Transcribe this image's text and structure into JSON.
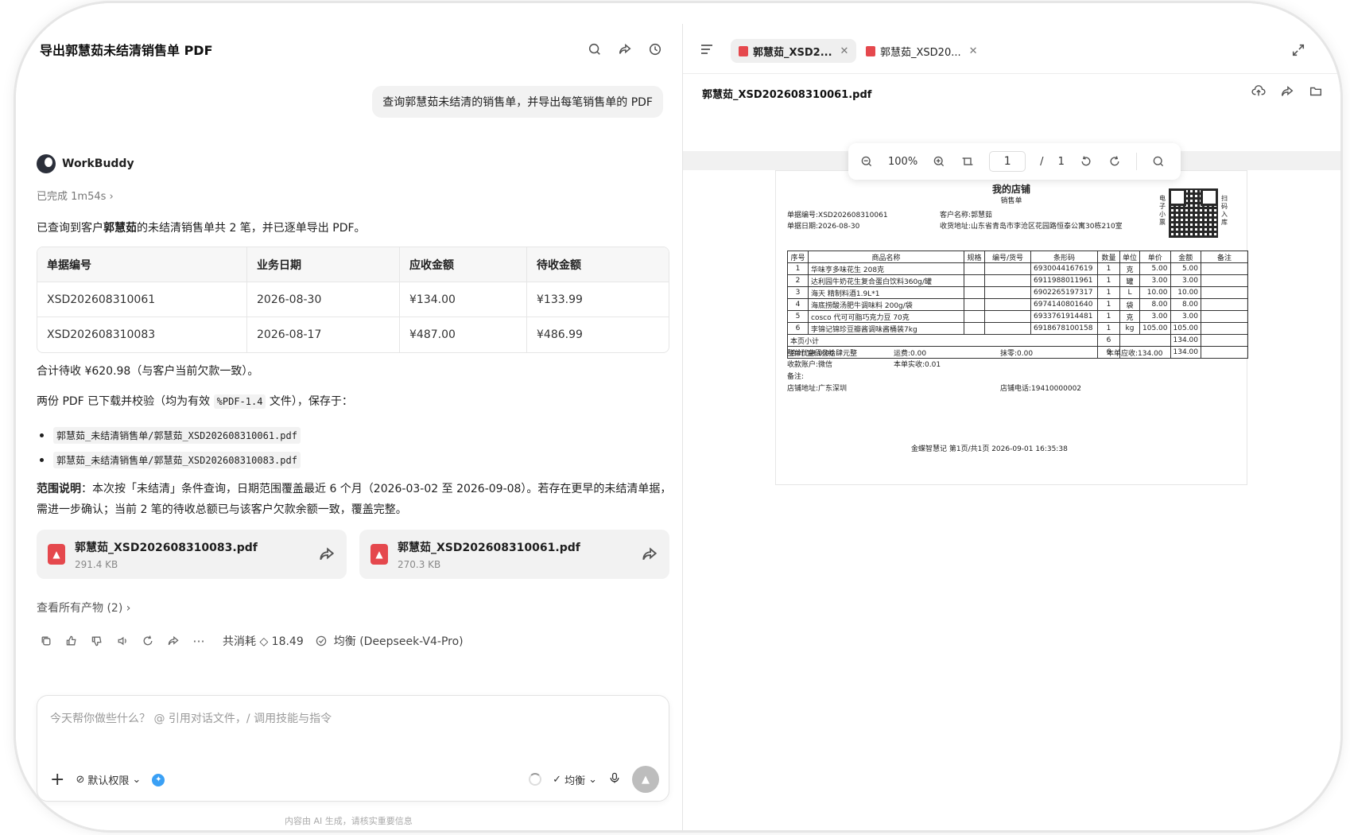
{
  "chat": {
    "title": "导出郭慧茹未结清销售单 PDF",
    "user_message": "查询郭慧茹未结清的销售单，并导出每笔销售单的 PDF",
    "agent_name": "WorkBuddy",
    "status": "已完成 1m54s",
    "summary_prefix": "已查询到客户",
    "summary_customer": "郭慧茹",
    "summary_suffix": "的未结清销售单共 2 笔，并已逐单导出 PDF。",
    "table": {
      "headers": [
        "单据编号",
        "业务日期",
        "应收金额",
        "待收金额"
      ],
      "rows": [
        [
          "XSD202608310061",
          "2026-08-30",
          "¥134.00",
          "¥133.99"
        ],
        [
          "XSD202608310083",
          "2026-08-17",
          "¥487.00",
          "¥486.99"
        ]
      ]
    },
    "total_line": "合计待收 ¥620.98（与客户当前欠款一致）。",
    "saved_prefix": "两份 PDF 已下载并校验（均为有效",
    "saved_code": "%PDF-1.4",
    "saved_suffix": "文件），保存于：",
    "paths": [
      "郭慧茹_未结清销售单/郭慧茹_XSD202608310061.pdf",
      "郭慧茹_未结清销售单/郭慧茹_XSD202608310083.pdf"
    ],
    "scope_label": "范围说明",
    "scope_text": "：本次按「未结清」条件查询，日期范围覆盖最近 6 个月（2026-03-02 至 2026-09-08）。若存在更早的未结清单据，需进一步确认；当前 2 笔的待收总额已与该客户欠款余额一致，覆盖完整。",
    "files": [
      {
        "name": "郭慧茹_XSD202608310083.pdf",
        "size": "291.4 KB"
      },
      {
        "name": "郭慧茹_XSD202608310061.pdf",
        "size": "270.3 KB"
      }
    ],
    "all_outputs": "查看所有产物 (2)",
    "cost": "共消耗 ◇ 18.49",
    "model": "均衡 (Deepseek-V4-Pro)",
    "input_placeholder": "今天帮你做些什么？ @ 引用对话文件，/ 调用技能与指令",
    "permission": "默认权限",
    "mode": "均衡",
    "footer": "内容由 AI 生成，请核实重要信息"
  },
  "viewer": {
    "tabs": [
      "郭慧茹_XSD2...",
      "郭慧茹_XSD20..."
    ],
    "file_title": "郭慧茹_XSD202608310061.pdf",
    "zoom": "100%",
    "page": "1",
    "page_total": "1",
    "pdf": {
      "store": "我的店铺",
      "doc_type": "销售单",
      "doc_no": "单据编号:XSD202608310061",
      "doc_date": "单据日期:2026-08-30",
      "customer": "客户名称:郭慧茹",
      "address": "收货地址:山东省青岛市李沧区花园路恒泰公寓30栋210室",
      "qr_left": "电子小票",
      "qr_right": "扫码入库",
      "headers": [
        "序号",
        "商品名称",
        "规格",
        "编号/货号",
        "条形码",
        "数量",
        "单位",
        "单价",
        "金额",
        "备注"
      ],
      "rows": [
        [
          "1",
          "华味亨多味花生 208克",
          "",
          "",
          "6930044167619",
          "1",
          "克",
          "5.00",
          "5.00",
          ""
        ],
        [
          "2",
          "达利园牛奶花生复合蛋白饮料360g/罐",
          "",
          "",
          "6911988011961",
          "1",
          "罐",
          "3.00",
          "3.00",
          ""
        ],
        [
          "3",
          "海天 精制料酒1.9L*1",
          "",
          "",
          "6902265197317",
          "1",
          "L",
          "10.00",
          "10.00",
          ""
        ],
        [
          "4",
          "海底捞酸汤肥牛调味料 200g/袋",
          "",
          "",
          "6974140801640",
          "1",
          "袋",
          "8.00",
          "8.00",
          ""
        ],
        [
          "5",
          "cosco 代可可脂巧克力豆 70克",
          "",
          "",
          "6933761914481",
          "1",
          "克",
          "3.00",
          "3.00",
          ""
        ],
        [
          "6",
          "李锦记锦珍豆瓣酱调味酱桶装7kg",
          "",
          "",
          "6918678100158",
          "1",
          "kg",
          "105.00",
          "105.00",
          ""
        ]
      ],
      "subtotal_label": "本页小计",
      "subtotal_qty": "6",
      "subtotal_amt": "134.00",
      "total_label": "合计:壹佰叁拾肆元整",
      "total_qty": "6",
      "total_amt": "134.00",
      "discount": "整单优惠:0.00",
      "freight": "运费:0.00",
      "rounding": "抹零:0.00",
      "receivable": "本单应收:134.00",
      "account": "收款账户:微信",
      "paid": "本单实收:0.01",
      "remark": "备注:",
      "shop_addr": "店铺地址:广东深圳",
      "shop_tel": "店铺电话:19410000002",
      "footer": "金蝶智慧记  第1页/共1页  2026-09-01 16:35:38"
    }
  }
}
